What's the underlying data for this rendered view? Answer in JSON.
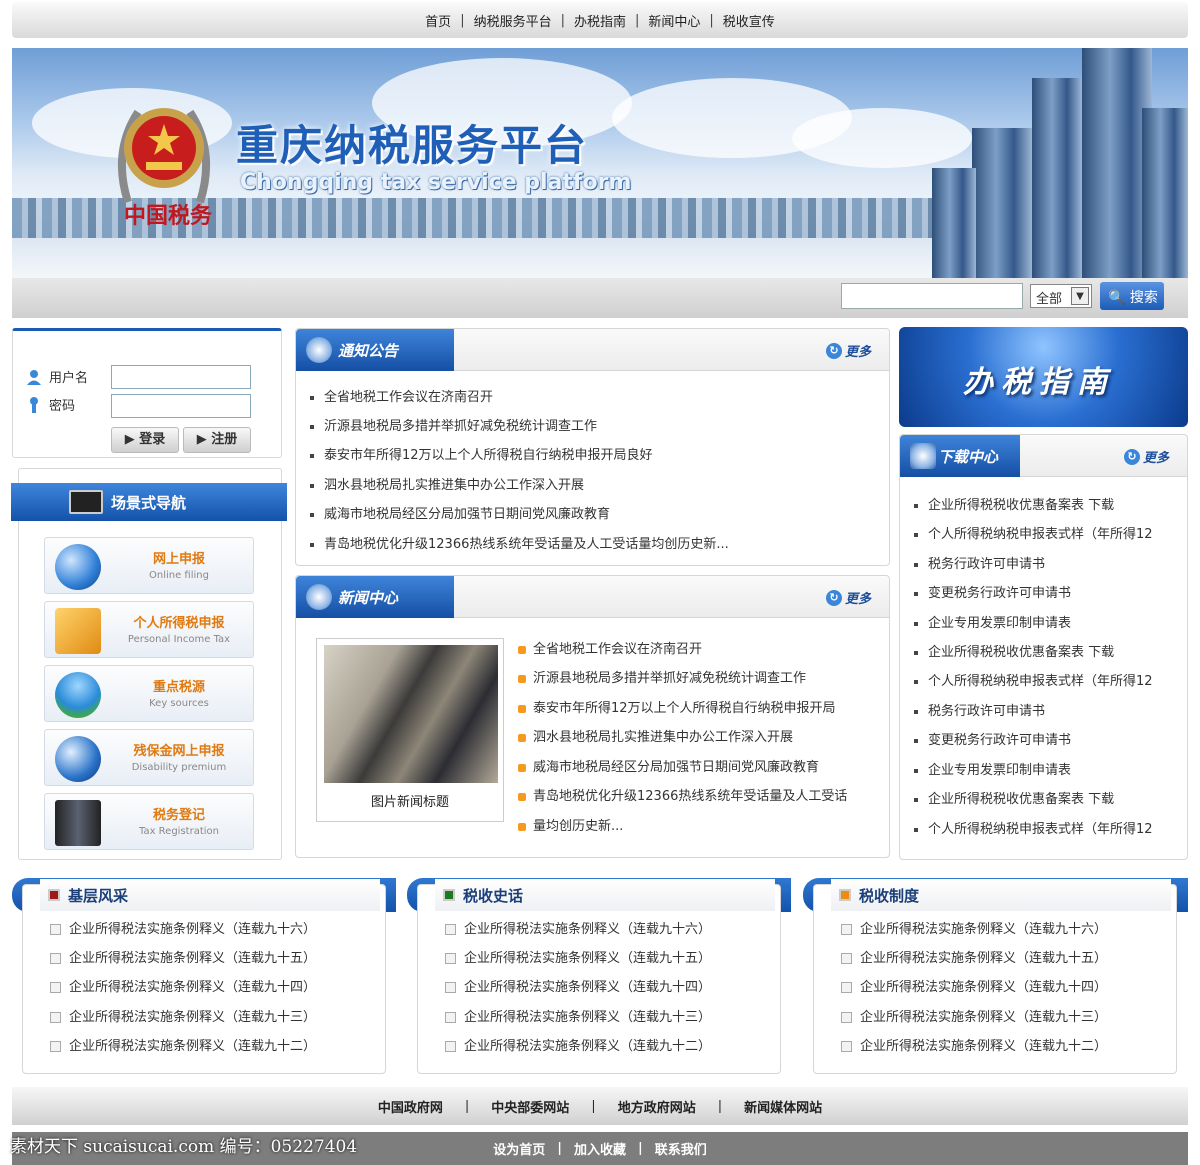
{
  "topnav": [
    "首页",
    "纳税服务平台",
    "办税指南",
    "新闻中心",
    "税收宣传"
  ],
  "banner": {
    "title": "重庆纳税服务平台",
    "subtitle": "Chongqing tax service platform",
    "china_tax": "中国税务"
  },
  "search": {
    "select_value": "全部",
    "button": "搜索"
  },
  "login": {
    "username_label": "用户名",
    "password_label": "密码",
    "login_button": "▶ 登录",
    "register_button": "▶ 注册"
  },
  "scene": {
    "title": "场景式导航",
    "items": [
      {
        "cn": "网上申报",
        "en": "Online filing"
      },
      {
        "cn": "个人所得税申报",
        "en": "Personal Income Tax"
      },
      {
        "cn": "重点税源",
        "en": "Key sources"
      },
      {
        "cn": "残保金网上申报",
        "en": "Disability premium"
      },
      {
        "cn": "税务登记",
        "en": "Tax Registration"
      }
    ]
  },
  "notice": {
    "title": "通知公告",
    "more": "更多",
    "items": [
      "全省地税工作会议在济南召开",
      "沂源县地税局多措并举抓好减免税统计调查工作",
      "泰安市年所得12万以上个人所得税自行纳税申报开局良好",
      "泗水县地税局扎实推进集中办公工作深入开展",
      "威海市地税局经区分局加强节日期间党风廉政教育",
      "青岛地税优化升级12366热线系统年受话量及人工受话量均创历史新..."
    ]
  },
  "news": {
    "title": "新闻中心",
    "more": "更多",
    "photo_caption": "图片新闻标题",
    "items": [
      "全省地税工作会议在济南召开",
      "沂源县地税局多措并举抓好减免税统计调查工作",
      "泰安市年所得12万以上个人所得税自行纳税申报开局",
      "泗水县地税局扎实推进集中办公工作深入开展",
      "威海市地税局经区分局加强节日期间党风廉政教育",
      "青岛地税优化升级12366热线系统年受话量及人工受话",
      "量均创历史新..."
    ]
  },
  "guide": {
    "title": "办税指南"
  },
  "download": {
    "title": "下载中心",
    "more": "更多",
    "items": [
      "企业所得税税收优惠备案表 下载",
      "个人所得税纳税申报表式样（年所得12",
      "税务行政许可申请书",
      "变更税务行政许可申请书",
      "企业专用发票印制申请表",
      "企业所得税税收优惠备案表 下载",
      "个人所得税纳税申报表式样（年所得12",
      "税务行政许可申请书",
      "变更税务行政许可申请书",
      "企业专用发票印制申请表",
      "企业所得税税收优惠备案表 下载",
      "个人所得税纳税申报表式样（年所得12"
    ]
  },
  "sections": [
    {
      "title": "基层风采",
      "color": "#a01818",
      "items": [
        "企业所得税法实施条例释义（连载九十六）",
        "企业所得税法实施条例释义（连载九十五）",
        "企业所得税法实施条例释义（连载九十四）",
        "企业所得税法实施条例释义（连载九十三）",
        "企业所得税法实施条例释义（连载九十二）"
      ]
    },
    {
      "title": "税收史话",
      "color": "#1f7a1f",
      "items": [
        "企业所得税法实施条例释义（连载九十六）",
        "企业所得税法实施条例释义（连载九十五）",
        "企业所得税法实施条例释义（连载九十四）",
        "企业所得税法实施条例释义（连载九十三）",
        "企业所得税法实施条例释义（连载九十二）"
      ]
    },
    {
      "title": "税收制度",
      "color": "#f08a10",
      "items": [
        "企业所得税法实施条例释义（连载九十六）",
        "企业所得税法实施条例释义（连载九十五）",
        "企业所得税法实施条例释义（连载九十四）",
        "企业所得税法实施条例释义（连载九十三）",
        "企业所得税法实施条例释义（连载九十二）"
      ]
    }
  ],
  "links": [
    "中国政府网",
    "中央部委网站",
    "地方政府网站",
    "新闻媒体网站"
  ],
  "footer": [
    "设为首页",
    "加入收藏",
    "联系我们"
  ],
  "watermark": "素材天下 sucaisucai.com  编号：05227404"
}
